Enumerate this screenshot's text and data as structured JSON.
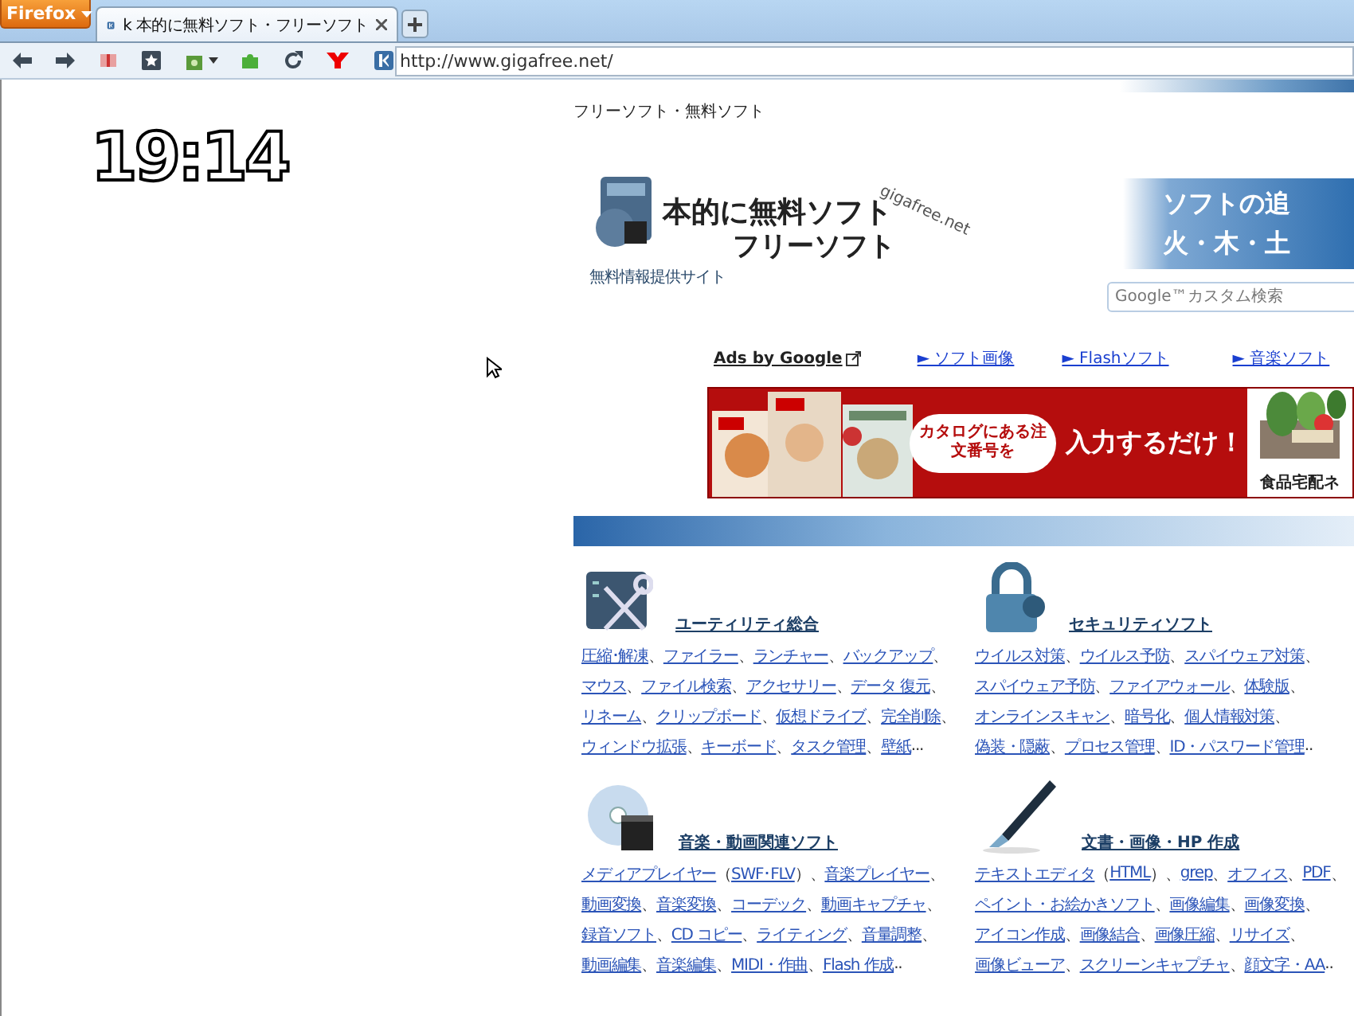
{
  "browser": {
    "menu_button": "Firefox",
    "tabs": [
      {
        "title": "k 本的に無料ソフト・フリーソフト",
        "selected": true
      }
    ],
    "url": "http://www.gigafree.net/"
  },
  "clock": "19:14",
  "page": {
    "tagline": "フリーソフト・無料ソフト",
    "logo": {
      "title": "本的に無料ソフト",
      "subtitle": "フリーソフト",
      "domain": "gigafree.net",
      "caption": "無料情報提供サイト"
    },
    "banner": [
      "ソフトの追",
      "火・木・土"
    ],
    "search": {
      "placeholder": "Google™カスタム検索"
    },
    "ads_label": "Ads by Google",
    "ad_links": [
      "► ソフト画像",
      "► Flashソフト",
      "► 音楽ソフト"
    ],
    "ad": {
      "callout": "カタログにある注文番号を",
      "headline": "入力するだけ！",
      "brand": "食品宅配ネ"
    },
    "categories": [
      {
        "kind": "tools",
        "title": "ユーティリティ総合",
        "lines": [
          [
            "圧縮･解凍",
            "、",
            "ファイラー",
            "、",
            "ランチャー",
            "、",
            "バックアップ",
            "、"
          ],
          [
            "マウス",
            "、",
            "ファイル検索",
            "、",
            "アクセサリー",
            "、",
            "データ 復元",
            "、"
          ],
          [
            "リネーム",
            "、",
            "クリップボード",
            "、",
            "仮想ドライブ",
            "、",
            "完全削除",
            "、"
          ],
          [
            "ウィンドウ拡張",
            "、",
            "キーボード",
            "、",
            "タスク管理",
            "、",
            "壁紙",
            "..."
          ]
        ]
      },
      {
        "kind": "lock",
        "title": "セキュリティソフト",
        "lines": [
          [
            "ウイルス対策",
            "、",
            "ウイルス予防",
            "、",
            "スパイウェア対策",
            "、"
          ],
          [
            "スパイウェア予防",
            "、",
            "ファイアウォール",
            "、",
            "体験版",
            "、"
          ],
          [
            "オンラインスキャン",
            "、",
            "暗号化",
            "、",
            "個人情報対策",
            "、"
          ],
          [
            "偽装・隠蔽",
            "、",
            "プロセス管理",
            "、",
            "ID・パスワード管理",
            ".."
          ]
        ]
      },
      {
        "kind": "disc",
        "title": "音楽・動画関連ソフト",
        "lines": [
          [
            "メディアプレイヤー",
            "（",
            "SWF･FLV",
            "）、",
            "音楽プレイヤー",
            "、"
          ],
          [
            "動画変換",
            "、",
            "音楽変換",
            "、",
            "コーデック",
            "、",
            "動画キャプチャ",
            "、"
          ],
          [
            "録音ソフト",
            "、",
            "CD コピー",
            "、",
            "ライティング",
            "、",
            "音量調整",
            "、"
          ],
          [
            "動画編集",
            "、",
            "音楽編集",
            "、",
            "MIDI・作曲",
            "、",
            "Flash 作成",
            ".."
          ]
        ]
      },
      {
        "kind": "pen",
        "title": "文書・画像・HP 作成",
        "lines": [
          [
            "テキストエディタ",
            "（",
            "HTML",
            "）、",
            "grep",
            "、",
            "オフィス",
            "、",
            "PDF",
            "、"
          ],
          [
            "ペイント・お絵かきソフト",
            "、",
            "画像編集",
            "、",
            "画像変換",
            "、"
          ],
          [
            "アイコン作成",
            "、",
            "画像結合",
            "、",
            "画像圧縮",
            "、",
            "リサイズ",
            "、"
          ],
          [
            "画像ビューア",
            "、",
            "スクリーンキャプチャ",
            "、",
            "顔文字・AA",
            ".."
          ]
        ]
      }
    ]
  }
}
